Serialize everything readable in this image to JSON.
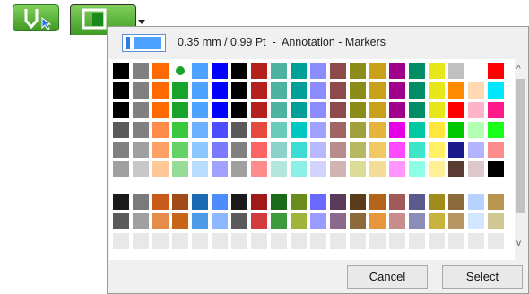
{
  "header": {
    "text": "0.35 mm / 0.99 Pt  -  Annotation - Markers"
  },
  "buttons": {
    "cancel": "Cancel",
    "select": "Select"
  },
  "icons": {
    "pen": "pen-select-icon",
    "marker": "marker-icon",
    "dropdown": "chevron-down-icon",
    "scroll_up": "^",
    "scroll_down": "v"
  },
  "selected_color": "#1aa32a",
  "palette_rows_top": [
    [
      "#000000",
      "#808080",
      "#ff6a00",
      "dot:#1aa32a",
      "#4da3ff",
      "#0000ff",
      "#000000",
      "#b3211a",
      "#4db3a0",
      "#00a096",
      "#8c8cff",
      "#8c4a4a",
      "#8c8c1a",
      "#c8a01a",
      "#a0008c",
      "#008c64",
      "#e6e61a",
      "#c0c0c0",
      "#ffffff",
      "#ff0000"
    ],
    [
      "#000000",
      "#808080",
      "#ff6a00",
      "#1aa32a",
      "#4da3ff",
      "#0000ff",
      "#000000",
      "#b3211a",
      "#4db3a0",
      "#00a096",
      "#8c8cff",
      "#8c4a4a",
      "#8c8c1a",
      "#c8a01a",
      "#a0008c",
      "#008c64",
      "#e6e61a",
      "#ff8c00",
      "#ffd9b3",
      "#00e6ff"
    ],
    [
      "#000000",
      "#808080",
      "#ff6a00",
      "#1aa32a",
      "#4da3ff",
      "#0000ff",
      "#000000",
      "#b3211a",
      "#4db3a0",
      "#00a096",
      "#8c8cff",
      "#8c4a4a",
      "#8c8c1a",
      "#c8a01a",
      "#a0008c",
      "#008c64",
      "#e6e61a",
      "#ff0000",
      "#ffb3c8",
      "#ff1a8c"
    ],
    [
      "#5a5a5a",
      "#808080",
      "#ff8c4a",
      "#3cc83c",
      "#6ab0ff",
      "#4d4dff",
      "#5a5a5a",
      "#e64a3c",
      "#6acbb8",
      "#00c8c0",
      "#a0a0ff",
      "#a06464",
      "#a0a03c",
      "#e6b43c",
      "#e600e6",
      "#00c8a0",
      "#ffe63c",
      "#00c800",
      "#b3ffb3",
      "#1aff1a"
    ],
    [
      "#808080",
      "#a0a0a0",
      "#ffa064",
      "#64d264",
      "#8cc8ff",
      "#7a7aff",
      "#808080",
      "#ff6464",
      "#8cd2c8",
      "#3cdcd2",
      "#b8b8ff",
      "#b88c8c",
      "#b8b864",
      "#f0c864",
      "#ff4aff",
      "#3ce6c8",
      "#fff064",
      "#1a1a8c",
      "#b3b3ff",
      "#ff8c8c"
    ],
    [
      "#a0a0a0",
      "#c8c8c8",
      "#ffc896",
      "#96dc96",
      "#b8dcff",
      "#a0a0ff",
      "#a0a0a0",
      "#ff8c8c",
      "#b3e6dc",
      "#8cf0e6",
      "#d2d2ff",
      "#d2b3b3",
      "#dcdc96",
      "#f5dc96",
      "#ff96ff",
      "#8cffe6",
      "#fff096",
      "#5a3c32",
      "#dcc8c8",
      "#000000"
    ]
  ],
  "palette_rows_bottom": [
    [
      "#1a1a1a",
      "#7a7a7a",
      "#c85a1a",
      "#a04a1a",
      "#1a6ab3",
      "#4d8cff",
      "#1a1a1a",
      "#a01a1a",
      "#1a6a1a",
      "#6a8c1a",
      "#6a6aff",
      "#5a3c5a",
      "#5a3c1a",
      "#b3641a",
      "#a05a5a",
      "#5a5a8c",
      "#a08c1a",
      "#8c6a3c",
      "#b8d2ff",
      "#b89650"
    ],
    [
      "#5a5a5a",
      "#a0a0a0",
      "#e68c4a",
      "#c8641a",
      "#4d9ae6",
      "#8cb8ff",
      "#5a5a5a",
      "#d23c3c",
      "#3c9a3c",
      "#a0b43c",
      "#9a9aff",
      "#8c6a8c",
      "#8c6a3c",
      "#e6963c",
      "#c88c8c",
      "#8c8cb8",
      "#c8b43c",
      "#b89664",
      "#d2e6ff",
      "#d2c896"
    ],
    [
      "#e8e8e8",
      "#e8e8e8",
      "#e8e8e8",
      "#e8e8e8",
      "#e8e8e8",
      "#e8e8e8",
      "#e8e8e8",
      "#e8e8e8",
      "#e8e8e8",
      "#e8e8e8",
      "#e8e8e8",
      "#e8e8e8",
      "#e8e8e8",
      "#e8e8e8",
      "#e8e8e8",
      "#e8e8e8",
      "#e8e8e8",
      "#e8e8e8",
      "#e8e8e8",
      "#e8e8e8"
    ]
  ]
}
